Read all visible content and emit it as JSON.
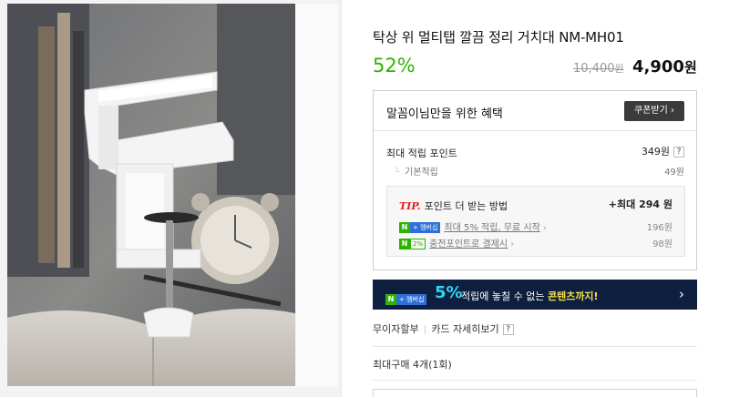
{
  "product": {
    "title": "탁상 위 멀티탭 깔끔 정리 거치대 NM-MH01",
    "discount": "52%",
    "original_price": "10,400",
    "original_price_unit": "원",
    "sale_price": "4,900",
    "sale_price_unit": "원"
  },
  "benefit": {
    "header": "말꼼이님만을 위한 혜택",
    "coupon_button": "쿠폰받기 ›",
    "max_points_label": "최대 적립 포인트",
    "max_points_value": "349원",
    "help_mark": "?",
    "basic_label": "기본적립",
    "basic_value": "49원",
    "tip": {
      "tip_word": "TIP.",
      "label": "포인트 더 받는 방법",
      "max": "+최대 294 원",
      "line1_badge_n": "N",
      "line1_badge_plus": "+ 멤버십",
      "line1_text": "최대 5% 적립, 무료 시작",
      "line1_arrow": "›",
      "line1_value": "196원",
      "line2_badge_n": "N",
      "line2_badge_pct": "2%",
      "line2_text": "충전포인트로 결제시",
      "line2_arrow": "›",
      "line2_value": "98원"
    }
  },
  "banner": {
    "badge_n": "N",
    "badge_plus": "+ 멤버십",
    "big": "5%",
    "text_pre": "적립에 놓칠 수 없는 ",
    "text_highlight": "콘텐츠까지!",
    "arrow": "›"
  },
  "options": {
    "installment": "무이자할부",
    "card_detail": "카드 자세히보기",
    "help_mark": "?"
  },
  "max_purchase": "최대구매 4개(1회)",
  "colors": {
    "discount": "#2db400",
    "tip_red": "#e31b1b",
    "banner_bg": "#0f1f3f",
    "banner_accent": "#2fd6f0"
  }
}
